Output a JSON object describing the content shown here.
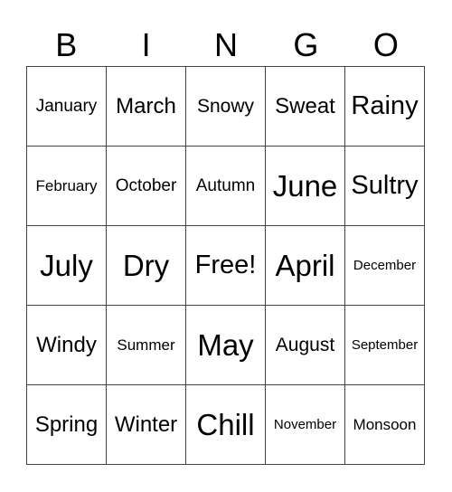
{
  "header": {
    "letters": [
      "B",
      "I",
      "N",
      "G",
      "O"
    ]
  },
  "board": {
    "rows": [
      [
        "January",
        "March",
        "Snowy",
        "Sweat",
        "Rainy"
      ],
      [
        "February",
        "October",
        "Autumn",
        "June",
        "Sultry"
      ],
      [
        "July",
        "Dry",
        "Free!",
        "April",
        "December"
      ],
      [
        "Windy",
        "Summer",
        "May",
        "August",
        "September"
      ],
      [
        "Spring",
        "Winter",
        "Chill",
        "November",
        "Monsoon"
      ]
    ]
  }
}
